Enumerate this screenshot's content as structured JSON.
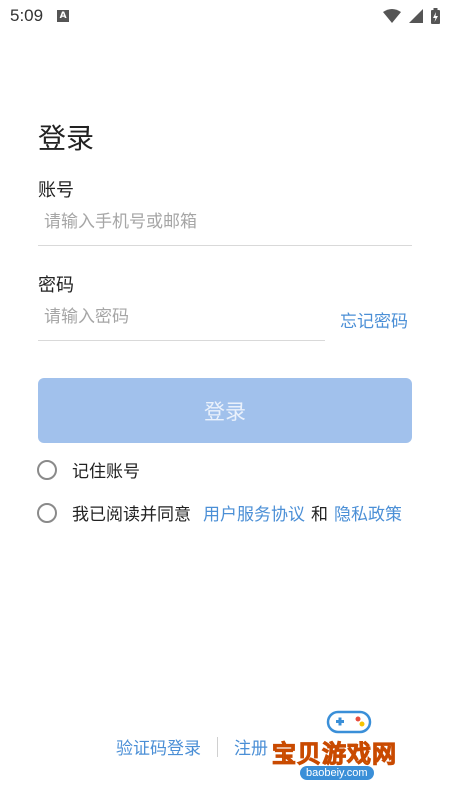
{
  "status_bar": {
    "time": "5:09",
    "notification_icon": "A",
    "icons": [
      "wifi-icon",
      "signal-icon",
      "battery-icon"
    ]
  },
  "page": {
    "title": "登录"
  },
  "form": {
    "account_label": "账号",
    "account_placeholder": "请输入手机号或邮箱",
    "password_label": "密码",
    "password_placeholder": "请输入密码",
    "forgot_password": "忘记密码",
    "login_button": "登录"
  },
  "options": {
    "remember_label": "记住账号",
    "agree_prefix": "我已阅读并同意",
    "user_agreement": "用户服务协议",
    "and_text": "和",
    "privacy_policy": "隐私政策"
  },
  "bottom": {
    "sms_login": "验证码登录",
    "register": "注册"
  },
  "watermark": {
    "text": "宝贝游戏网",
    "url": "baobeiy.com"
  },
  "colors": {
    "accent": "#4b8fd6",
    "button_bg": "#a1c1ec"
  }
}
